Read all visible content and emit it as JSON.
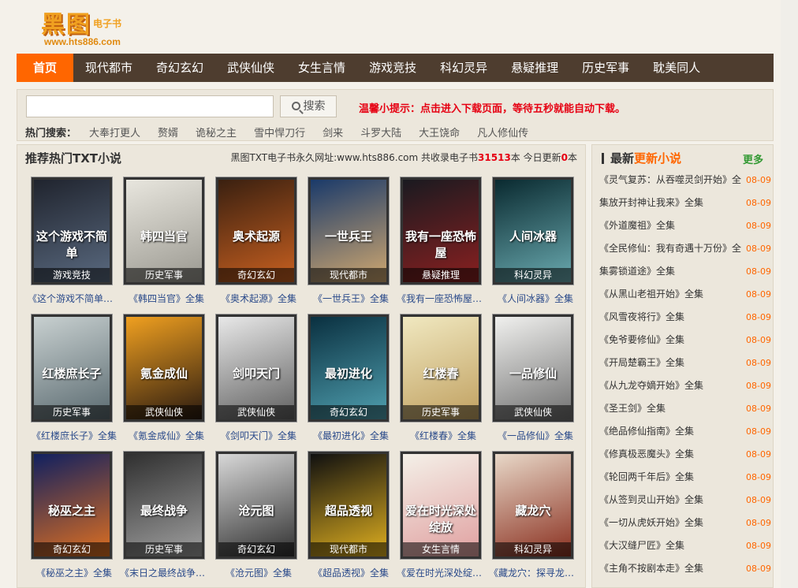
{
  "logo": {
    "main": "黑图",
    "sub": "电子书",
    "url": "www.hts886.com"
  },
  "nav": [
    "首页",
    "现代都市",
    "奇幻玄幻",
    "武侠仙侠",
    "女生言情",
    "游戏竞技",
    "科幻灵异",
    "悬疑推理",
    "历史军事",
    "耽美同人"
  ],
  "search": {
    "value": "",
    "button": "搜索",
    "tip": "温馨小提示：点击进入下载页面，等待五秒就能自动下载。"
  },
  "hot": {
    "label": "热门搜索：",
    "items": [
      "大奉打更人",
      "赘婿",
      "诡秘之主",
      "雪中悍刀行",
      "剑来",
      "斗罗大陆",
      "大王饶命",
      "凡人修仙传"
    ]
  },
  "main": {
    "title": "推荐热门TXT小说",
    "info_prefix": "黑图TXT电子书永久网址:www.hts886.com 共收录电子书",
    "total": "31513",
    "info_mid": "本 今日更新",
    "today": "0",
    "info_suffix": "本"
  },
  "books": [
    {
      "title": "这个游戏不简单",
      "cat": "游戏竞技",
      "name": "《这个游戏不简单》全集",
      "colors": [
        "#20242e",
        "#5a6a80"
      ]
    },
    {
      "title": "韩四当官",
      "cat": "历史军事",
      "name": "《韩四当官》全集",
      "colors": [
        "#e8e6de",
        "#9a9890"
      ]
    },
    {
      "title": "奥术起源",
      "cat": "奇幻玄幻",
      "name": "《奥术起源》全集",
      "colors": [
        "#3a2010",
        "#c86020"
      ]
    },
    {
      "title": "一世兵王",
      "cat": "现代都市",
      "name": "《一世兵王》全集",
      "colors": [
        "#1a3a6a",
        "#d0a870"
      ]
    },
    {
      "title": "我有一座恐怖屋",
      "cat": "悬疑推理",
      "name": "《我有一座恐怖屋》全集",
      "colors": [
        "#1a1a20",
        "#8a2020"
      ]
    },
    {
      "title": "人间冰器",
      "cat": "科幻灵异",
      "name": "《人间冰器》全集",
      "colors": [
        "#0a2a30",
        "#6aaab0"
      ]
    },
    {
      "title": "红楼庶长子",
      "cat": "历史军事",
      "name": "《红楼庶长子》全集",
      "colors": [
        "#c8d0d0",
        "#5a6a70"
      ]
    },
    {
      "title": "氪金成仙",
      "cat": "武侠仙侠",
      "name": "《氪金成仙》全集",
      "colors": [
        "#f0a020",
        "#2a1a10"
      ]
    },
    {
      "title": "剑叩天门",
      "cat": "武侠仙侠",
      "name": "《剑叩天门》全集",
      "colors": [
        "#e8e8e8",
        "#606060"
      ]
    },
    {
      "title": "最初进化",
      "cat": "奇幻玄幻",
      "name": "《最初进化》全集",
      "colors": [
        "#0a3040",
        "#50a0b0"
      ]
    },
    {
      "title": "红楼春",
      "cat": "历史军事",
      "name": "《红楼春》全集",
      "colors": [
        "#f0e8c0",
        "#c0a060"
      ]
    },
    {
      "title": "一品修仙",
      "cat": "武侠仙侠",
      "name": "《一品修仙》全集",
      "colors": [
        "#f0f0ee",
        "#707070"
      ]
    },
    {
      "title": "秘巫之主",
      "cat": "奇幻玄幻",
      "name": "《秘巫之主》全集",
      "colors": [
        "#102060",
        "#e07020"
      ]
    },
    {
      "title": "最终战争",
      "cat": "历史军事",
      "name": "《末日之最终战争》全集",
      "colors": [
        "#303030",
        "#a0a0a0"
      ]
    },
    {
      "title": "沧元图",
      "cat": "奇幻玄幻",
      "name": "《沧元图》全集",
      "colors": [
        "#d8d8d8",
        "#303030"
      ]
    },
    {
      "title": "超品透视",
      "cat": "现代都市",
      "name": "《超品透视》全集",
      "colors": [
        "#101010",
        "#e0b020"
      ]
    },
    {
      "title": "爱在时光深处绽放",
      "cat": "女生言情",
      "name": "《爱在时光深处绽放》全集",
      "colors": [
        "#f4f0e8",
        "#e0a0a0"
      ]
    },
    {
      "title": "藏龙穴",
      "cat": "科幻灵异",
      "name": "《藏龙穴：探寻龙脉》全集",
      "colors": [
        "#e8d8c8",
        "#8a3020"
      ]
    }
  ],
  "side": {
    "title_prefix": "最新",
    "title_hl": "更新小说",
    "more": "更多",
    "items": [
      {
        "name": "《灵气复苏：从吞噬灵剑开始》全",
        "date": "08-09"
      },
      {
        "name": "集放开封神让我来》全集",
        "date": "08-09"
      },
      {
        "name": "《外道魔祖》全集",
        "date": "08-09"
      },
      {
        "name": "《全民修仙：我有奇遇十万份》全",
        "date": "08-09"
      },
      {
        "name": "集雾锁道途》全集",
        "date": "08-09"
      },
      {
        "name": "《从黑山老祖开始》全集",
        "date": "08-09"
      },
      {
        "name": "《风雪夜将行》全集",
        "date": "08-09"
      },
      {
        "name": "《免爷要修仙》全集",
        "date": "08-09"
      },
      {
        "name": "《开局楚霸王》全集",
        "date": "08-09"
      },
      {
        "name": "《从九龙夺嫡开始》全集",
        "date": "08-09"
      },
      {
        "name": "《圣王剑》全集",
        "date": "08-09"
      },
      {
        "name": "《绝品修仙指南》全集",
        "date": "08-09"
      },
      {
        "name": "《修真极恶魔头》全集",
        "date": "08-09"
      },
      {
        "name": "《轮回两千年后》全集",
        "date": "08-09"
      },
      {
        "name": "《从签到灵山开始》全集",
        "date": "08-09"
      },
      {
        "name": "《一切从虎妖开始》全集",
        "date": "08-09"
      },
      {
        "name": "《大汉缝尸匠》全集",
        "date": "08-09"
      },
      {
        "name": "《主角不按剧本走》全集",
        "date": "08-09"
      }
    ]
  }
}
